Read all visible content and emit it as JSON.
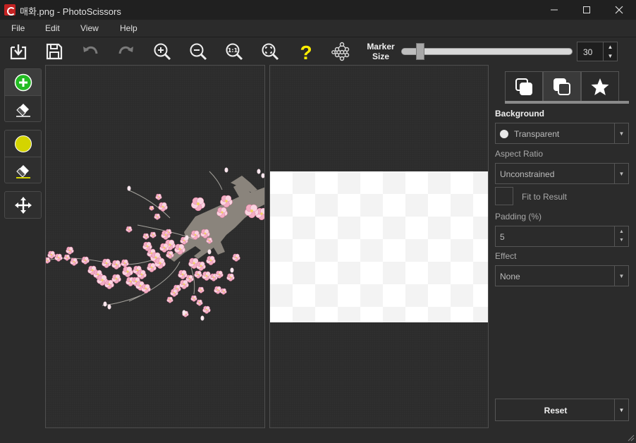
{
  "window": {
    "title": "매화.png - PhotoScissors",
    "minimize_icon": "minimize-icon",
    "maximize_icon": "maximize-icon",
    "close_icon": "close-icon"
  },
  "menu": [
    "File",
    "Edit",
    "View",
    "Help"
  ],
  "toolbar": {
    "icons": [
      "open-icon",
      "save-icon",
      "undo-icon",
      "redo-icon",
      "zoom-in-icon",
      "zoom-out-icon",
      "actual-size-icon",
      "fit-icon",
      "help-icon",
      "network-icon"
    ],
    "marker_label_1": "Marker",
    "marker_label_2": "Size",
    "marker_size": "30",
    "marker_fraction": 0.1
  },
  "left_tools": [
    "foreground-marker-icon",
    "foreground-eraser-icon",
    "background-marker-icon",
    "background-eraser-icon",
    "move-icon"
  ],
  "right_panel": {
    "tabs": [
      "background-tab-icon",
      "foreground-tab-icon",
      "favorites-star-icon"
    ],
    "background_label": "Background",
    "background_value": "Transparent",
    "aspect_label": "Aspect Ratio",
    "aspect_value": "Unconstrained",
    "fit_label": "Fit to Result",
    "padding_label": "Padding (%)",
    "padding_value": "5",
    "effect_label": "Effect",
    "effect_value": "None",
    "reset_label": "Reset"
  },
  "colors": {
    "foreground_marker": "#22bb22",
    "background_marker": "#d4d400",
    "help": "#ffee00",
    "blossom": "#f4aec4",
    "branch": "#8a847c"
  }
}
